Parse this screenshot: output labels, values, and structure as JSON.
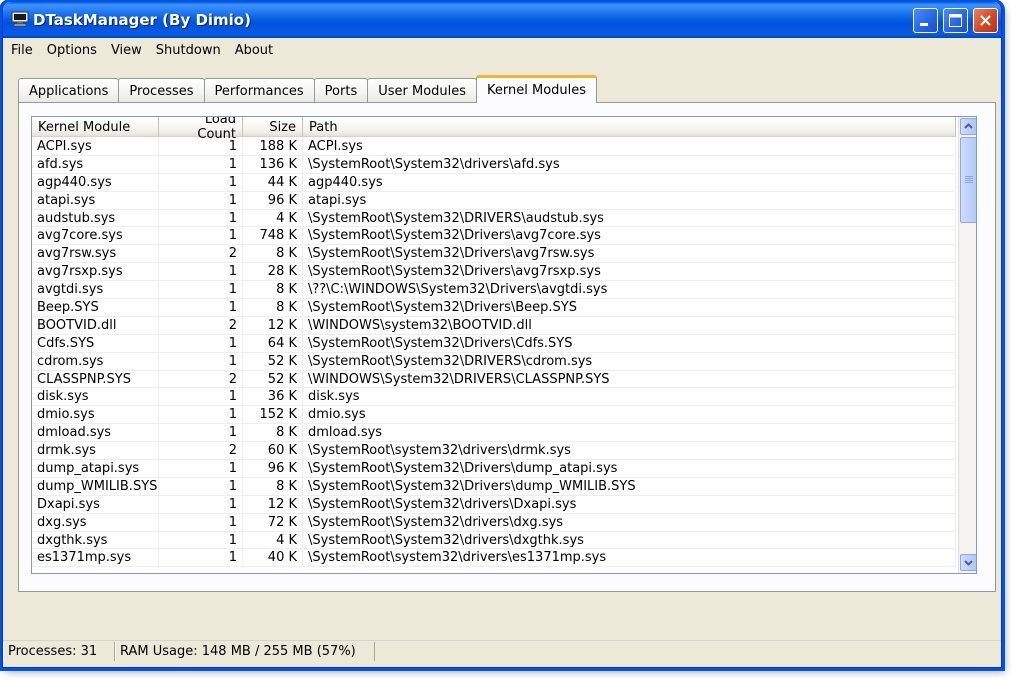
{
  "window": {
    "title": "DTaskManager (By Dimio)"
  },
  "menu": [
    "File",
    "Options",
    "View",
    "Shutdown",
    "About"
  ],
  "tabs": [
    {
      "label": "Applications",
      "active": false
    },
    {
      "label": "Processes",
      "active": false
    },
    {
      "label": "Performances",
      "active": false
    },
    {
      "label": "Ports",
      "active": false
    },
    {
      "label": "User Modules",
      "active": false
    },
    {
      "label": "Kernel Modules",
      "active": true
    }
  ],
  "table": {
    "columns": [
      "Kernel Module",
      "Load Count",
      "Size",
      "Path"
    ],
    "rows": [
      [
        "ACPI.sys",
        "1",
        "188 K",
        "ACPI.sys"
      ],
      [
        "afd.sys",
        "1",
        "136 K",
        "\\SystemRoot\\System32\\drivers\\afd.sys"
      ],
      [
        "agp440.sys",
        "1",
        "44 K",
        "agp440.sys"
      ],
      [
        "atapi.sys",
        "1",
        "96 K",
        "atapi.sys"
      ],
      [
        "audstub.sys",
        "1",
        "4 K",
        "\\SystemRoot\\System32\\DRIVERS\\audstub.sys"
      ],
      [
        "avg7core.sys",
        "1",
        "748 K",
        "\\SystemRoot\\System32\\Drivers\\avg7core.sys"
      ],
      [
        "avg7rsw.sys",
        "2",
        "8 K",
        "\\SystemRoot\\System32\\Drivers\\avg7rsw.sys"
      ],
      [
        "avg7rsxp.sys",
        "1",
        "28 K",
        "\\SystemRoot\\System32\\Drivers\\avg7rsxp.sys"
      ],
      [
        "avgtdi.sys",
        "1",
        "8 K",
        "\\??\\C:\\WINDOWS\\System32\\Drivers\\avgtdi.sys"
      ],
      [
        "Beep.SYS",
        "1",
        "8 K",
        "\\SystemRoot\\System32\\Drivers\\Beep.SYS"
      ],
      [
        "BOOTVID.dll",
        "2",
        "12 K",
        "\\WINDOWS\\system32\\BOOTVID.dll"
      ],
      [
        "Cdfs.SYS",
        "1",
        "64 K",
        "\\SystemRoot\\System32\\Drivers\\Cdfs.SYS"
      ],
      [
        "cdrom.sys",
        "1",
        "52 K",
        "\\SystemRoot\\System32\\DRIVERS\\cdrom.sys"
      ],
      [
        "CLASSPNP.SYS",
        "2",
        "52 K",
        "\\WINDOWS\\System32\\DRIVERS\\CLASSPNP.SYS"
      ],
      [
        "disk.sys",
        "1",
        "36 K",
        "disk.sys"
      ],
      [
        "dmio.sys",
        "1",
        "152 K",
        "dmio.sys"
      ],
      [
        "dmload.sys",
        "1",
        "8 K",
        "dmload.sys"
      ],
      [
        "drmk.sys",
        "2",
        "60 K",
        "\\SystemRoot\\system32\\drivers\\drmk.sys"
      ],
      [
        "dump_atapi.sys",
        "1",
        "96 K",
        "\\SystemRoot\\System32\\Drivers\\dump_atapi.sys"
      ],
      [
        "dump_WMILIB.SYS",
        "1",
        "8 K",
        "\\SystemRoot\\System32\\Drivers\\dump_WMILIB.SYS"
      ],
      [
        "Dxapi.sys",
        "1",
        "12 K",
        "\\SystemRoot\\System32\\drivers\\Dxapi.sys"
      ],
      [
        "dxg.sys",
        "1",
        "72 K",
        "\\SystemRoot\\System32\\drivers\\dxg.sys"
      ],
      [
        "dxgthk.sys",
        "1",
        "4 K",
        "\\SystemRoot\\System32\\drivers\\dxgthk.sys"
      ],
      [
        "es1371mp.sys",
        "1",
        "40 K",
        "\\SystemRoot\\system32\\drivers\\es1371mp.sys"
      ]
    ]
  },
  "status": {
    "processes": "Processes: 31",
    "ram": "RAM Usage:  148 MB / 255 MB (57%)"
  },
  "icons": {
    "app": "computer-icon",
    "minimize": "minimize-icon",
    "maximize": "maximize-icon",
    "close": "close-icon"
  },
  "colors": {
    "titlebar": "#0054e3",
    "window_bg": "#ece9d8",
    "active_tab_accent": "#f7b42c",
    "close_button": "#d2451d"
  }
}
